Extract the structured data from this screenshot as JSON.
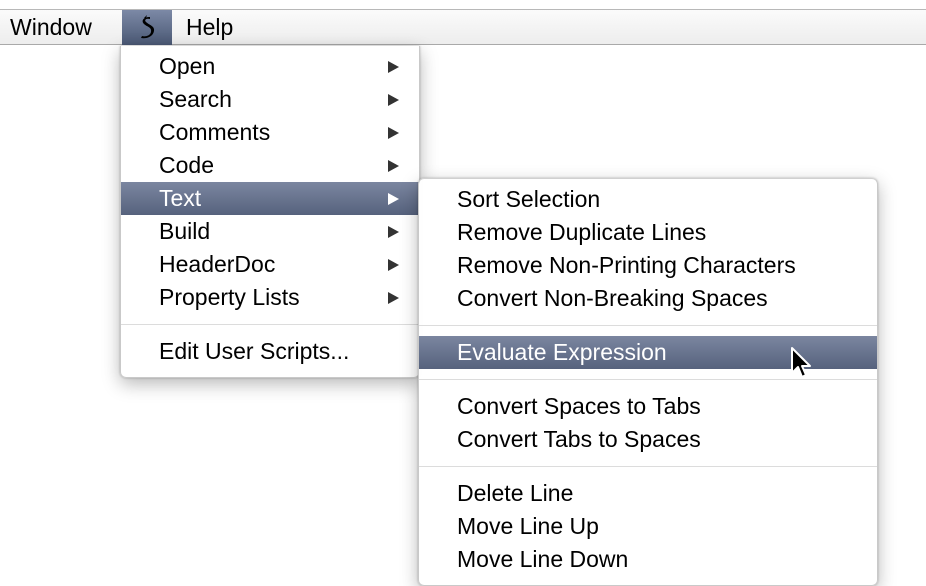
{
  "menubar": {
    "window_label": "Window",
    "script_icon": "script-icon",
    "help_label": "Help"
  },
  "main_menu": {
    "items": [
      {
        "label": "Open",
        "submenu": true
      },
      {
        "label": "Search",
        "submenu": true
      },
      {
        "label": "Comments",
        "submenu": true
      },
      {
        "label": "Code",
        "submenu": true
      },
      {
        "label": "Text",
        "submenu": true,
        "selected": true
      },
      {
        "label": "Build",
        "submenu": true
      },
      {
        "label": "HeaderDoc",
        "submenu": true
      },
      {
        "label": "Property Lists",
        "submenu": true
      }
    ],
    "footer_item": "Edit User Scripts..."
  },
  "text_submenu": {
    "group1": [
      "Sort Selection",
      "Remove Duplicate Lines",
      "Remove Non-Printing Characters",
      "Convert Non-Breaking Spaces"
    ],
    "selected_item": "Evaluate Expression",
    "group2": [
      "Convert Spaces to Tabs",
      "Convert Tabs to Spaces"
    ],
    "group3": [
      "Delete Line",
      "Move Line Up",
      "Move Line Down"
    ]
  },
  "colors": {
    "selection": "#5f6b86",
    "menubar": "#f2f2f2"
  }
}
